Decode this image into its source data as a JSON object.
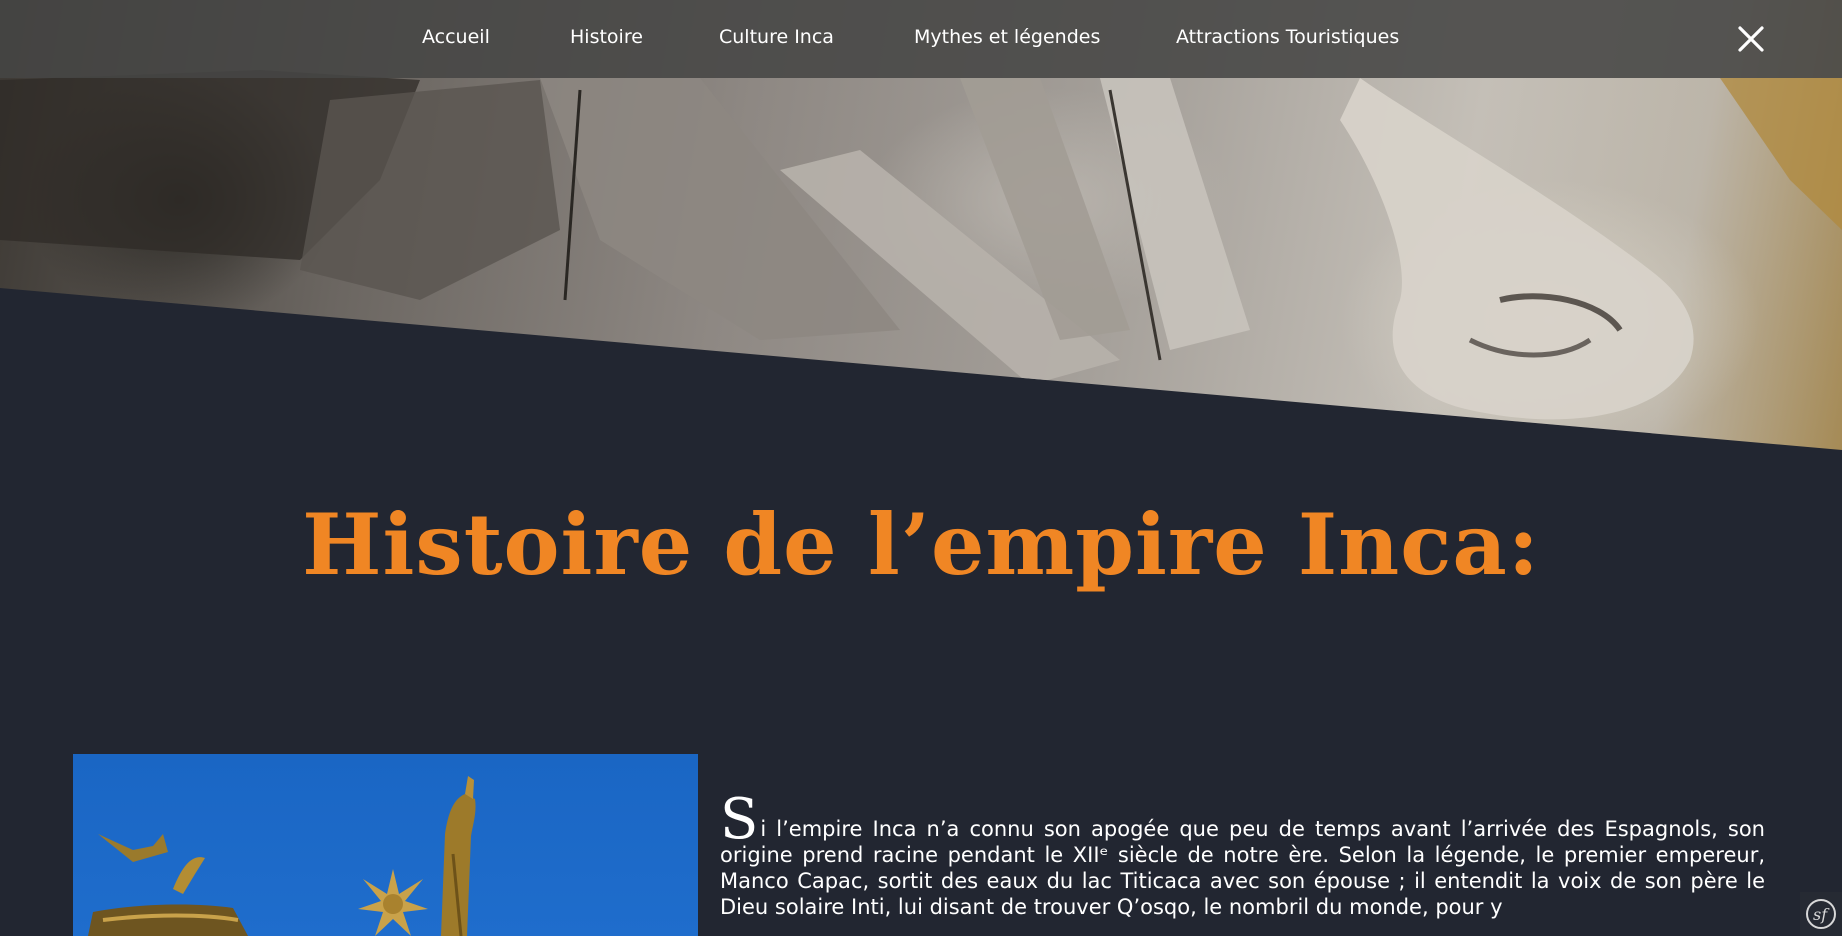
{
  "nav": {
    "items": [
      {
        "label": "Accueil"
      },
      {
        "label": "Histoire"
      },
      {
        "label": "Culture Inca"
      },
      {
        "label": "Mythes et légendes"
      },
      {
        "label": "Attractions Touristiques"
      }
    ],
    "close_icon": "close-icon"
  },
  "hero": {
    "image": "stone-carving-inca-face"
  },
  "main": {
    "title": "Histoire de l’empire Inca:",
    "image": "golden-statue-blue-sky",
    "paragraph_dropcap": "S",
    "paragraph_text": "i l’empire Inca n’a connu son apogée que peu de temps avant l’arrivée des Espagnols, son origine prend racine pendant le XIIᵉ siècle de notre ère. Selon la légende, le premier empereur, Manco Capac, sortit des eaux du lac Titicaca avec son épouse ; il entendit la voix de son père le Dieu solaire Inti, lui disant de trouver Q’osqo, le nombril du monde, pour y"
  },
  "footer": {
    "badge_icon": "symfony-icon"
  },
  "colors": {
    "background": "#222631",
    "accent": "#f08624",
    "nav_bg": "#464644",
    "text": "#ffffff"
  }
}
